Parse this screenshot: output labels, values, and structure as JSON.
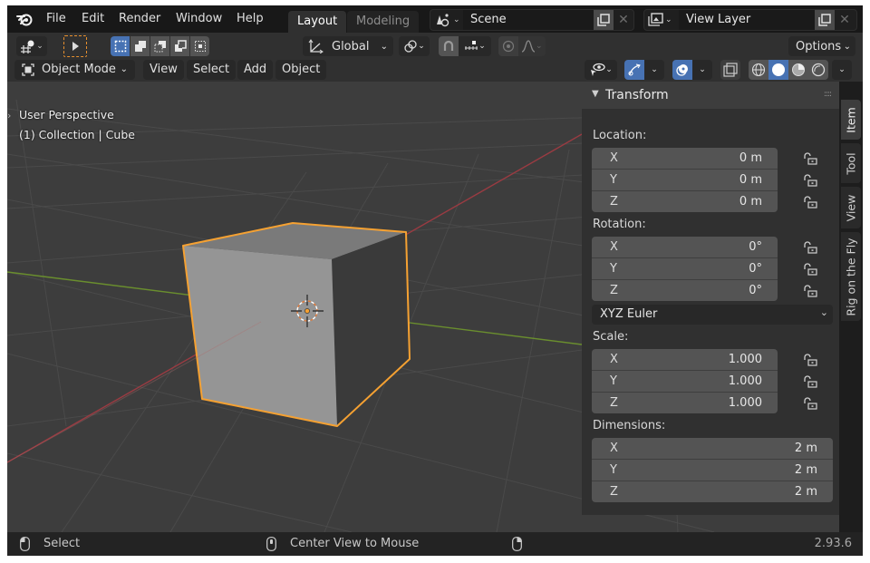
{
  "topbar": {
    "menu": [
      "File",
      "Edit",
      "Render",
      "Window",
      "Help"
    ],
    "workspaces": [
      {
        "label": "Layout",
        "active": true
      },
      {
        "label": "Modeling",
        "active": false
      }
    ],
    "scene": {
      "icon": "scene-icon",
      "value": "Scene"
    },
    "view_layer": {
      "icon": "view-layer-icon",
      "value": "View Layer"
    }
  },
  "toolbar": {
    "transform_orientation": "Global",
    "options_label": "Options",
    "select_modes": [
      "select-box-new-icon",
      "select-extend-icon",
      "select-subtract-icon",
      "select-invert-icon",
      "select-intersect-icon"
    ]
  },
  "header": {
    "mode": "Object Mode",
    "menus": [
      "View",
      "Select",
      "Add",
      "Object"
    ]
  },
  "viewport": {
    "perspective_label": "User Perspective",
    "collection_label": "(1) Collection | Cube",
    "selected_object": "Cube",
    "selection_color": "#f5a132",
    "x_axis_color": "#9a3b42",
    "y_axis_color": "#6a8e2e"
  },
  "npanel": {
    "title": "Transform",
    "location": {
      "label": "Location:",
      "rows": [
        {
          "axis": "X",
          "value": "0 m"
        },
        {
          "axis": "Y",
          "value": "0 m"
        },
        {
          "axis": "Z",
          "value": "0 m"
        }
      ]
    },
    "rotation": {
      "label": "Rotation:",
      "rows": [
        {
          "axis": "X",
          "value": "0°"
        },
        {
          "axis": "Y",
          "value": "0°"
        },
        {
          "axis": "Z",
          "value": "0°"
        }
      ],
      "mode": "XYZ Euler"
    },
    "scale": {
      "label": "Scale:",
      "rows": [
        {
          "axis": "X",
          "value": "1.000"
        },
        {
          "axis": "Y",
          "value": "1.000"
        },
        {
          "axis": "Z",
          "value": "1.000"
        }
      ]
    },
    "dimensions": {
      "label": "Dimensions:",
      "rows": [
        {
          "axis": "X",
          "value": "2 m"
        },
        {
          "axis": "Y",
          "value": "2 m"
        },
        {
          "axis": "Z",
          "value": "2 m"
        }
      ]
    }
  },
  "sidebar_tabs": [
    {
      "label": "Item",
      "active": true
    },
    {
      "label": "Tool",
      "active": false
    },
    {
      "label": "View",
      "active": false
    },
    {
      "label": "Rig on the Fly",
      "active": false
    }
  ],
  "statusbar": {
    "left_action": "Select",
    "middle_action": "Center View to Mouse",
    "version": "2.93.6"
  }
}
